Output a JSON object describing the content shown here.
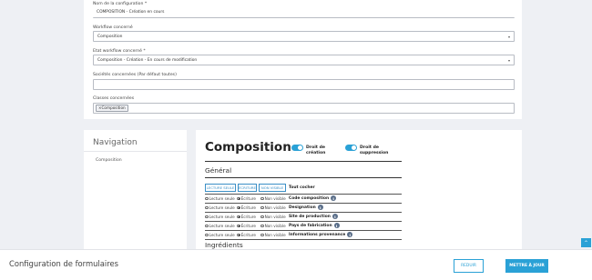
{
  "config": {
    "name_label": "Nom de la configuration *",
    "name_value": "COMPOSITION - Création en cours",
    "workflow_label": "Workflow concerné",
    "workflow_value": "Composition",
    "state_label": "Etat workflow concerné *",
    "state_value": "Composition - Création - En cours de modification",
    "societies_label": "Sociétés concernées (Par défaut toutes)",
    "societies_value": "",
    "classes_label": "Classes concernées",
    "classes_tag": "×Composition"
  },
  "navigation": {
    "title": "Navigation",
    "items": [
      "Composition"
    ]
  },
  "main": {
    "title": "Composition",
    "toggles": [
      {
        "label": "Droit de création",
        "on": true
      },
      {
        "label": "Droit de suppression",
        "on": true
      }
    ],
    "sections": [
      "Général",
      "Ingrédients"
    ],
    "header_buttons": [
      "LECTURE SEULE",
      "ÉCRITURE",
      "NON VISIBLE"
    ],
    "toggle_all_label": "Tout cocher",
    "radio_labels": [
      "Lecture seule",
      "Écriture",
      "Non visible"
    ],
    "fields": [
      {
        "name": "Code composition",
        "selected": "Écriture",
        "info": "i"
      },
      {
        "name": "Designation",
        "selected": "Écriture",
        "info": "i"
      },
      {
        "name": "Site de production",
        "selected": "Écriture",
        "info": "i"
      },
      {
        "name": "Pays de fabrication",
        "selected": "Écriture",
        "info": "i"
      },
      {
        "name": "Informations provenance",
        "selected": "Écriture",
        "info": "i"
      }
    ]
  },
  "footer": {
    "title": "Configuration de formulaires",
    "reset_label": "REDUIR",
    "update_label": "METTRE À JOUR"
  },
  "scroll_top_icon": "chevron-up-icon",
  "colors": {
    "accent": "#2aa1d6",
    "background": "#eef0f4"
  }
}
